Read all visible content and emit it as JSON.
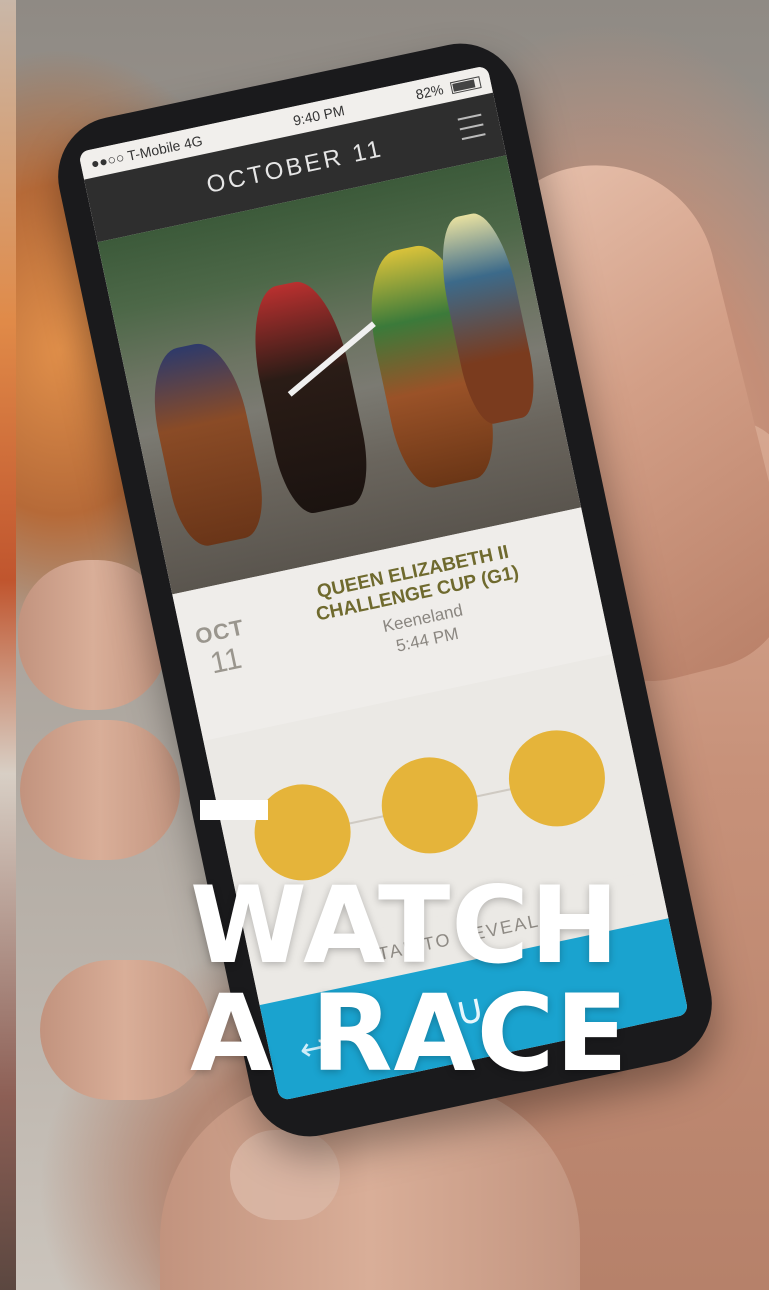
{
  "phone": {
    "status_bar": {
      "carrier": "●●○○ T-Mobile 4G",
      "time": "9:40 PM",
      "battery": "82%"
    },
    "nav_title": "OCTOBER 11",
    "race": {
      "month": "OCT",
      "day": "11",
      "name": "QUEEN ELIZABETH II CHALLENGE CUP (G1)",
      "venue": "Keeneland",
      "time": "5:44 PM"
    },
    "reveal_label": "TAP TO REVEAL",
    "colors": {
      "accent_circle": "#e5b43a",
      "bottom_bar": "#1aa3cf"
    }
  },
  "overlay": {
    "line1": "WATCH",
    "line2": "A RACE"
  }
}
